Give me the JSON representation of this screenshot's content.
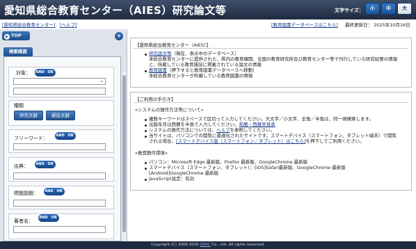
{
  "header": {
    "title": "愛知県総合教育センター（AIES）研究論文等",
    "font_size_label": "文字サイズ：",
    "font_sizes": [
      "小",
      "中",
      "大"
    ],
    "font_size_active": "大"
  },
  "linkbar": {
    "home_link": "[愛知県総合教育センター]",
    "help_link": "[ヘルプ]",
    "db_link": "[教育図書データベースはこちら]",
    "updated": "最終更新日： 2025年10月16日"
  },
  "left": {
    "top_label": "TOP",
    "top_icon": "arrow-icon",
    "add_icon": "plus-icon",
    "tab_label": "検索画面",
    "fields": {
      "target_label": "対象：",
      "type_label": "種類",
      "type_buttons": [
        "研究文献",
        "雑誌文献"
      ],
      "freeword_label": "フリーワード：",
      "source_label": "出典：",
      "title_label": "標題副題：",
      "author_label": "著者名："
    },
    "and_label": "AND",
    "or_label": "OR"
  },
  "main": {
    "about_title": "【愛知県総合教育センター（AIES）】",
    "about_items": [
      {
        "link": "研究論文等",
        "suffix": "（現在、表示中のデータベース）",
        "desc1": "本総合教育センターに提供された、県内の教育機関、全国の教育研究所及び教育センター等で刊行している研究紀要の情報",
        "desc2": "と、所蔵している教育雑誌に掲載されている論文の情報"
      },
      {
        "link": "教育図書",
        "suffix": "（押下すると教育図書データベースへ移動）",
        "desc1": "本総合教育センターが所蔵している教育図書の情報",
        "desc2": ""
      }
    ],
    "guide_title": "【ご利用の手引き】",
    "system_heading": "«システムの操作方法等について»",
    "system_items": [
      {
        "pre": "複数キーワードはスペースで区切って入力してください。大文字／小文字、全角／半角は、同一視検索します。",
        "link": "",
        "post": ""
      },
      {
        "pre": "出版年月は西暦を半角で入力してください。",
        "link": "和暦・西暦早見表",
        "post": ""
      },
      {
        "pre": "システムの操作方法については、",
        "link": "ヘルプ",
        "post": "を参照してください。"
      },
      {
        "pre": "当サイトは、パソコンでの閲覧に最適化されたサイトです。スマートデバイス（スマートフォン、タブレット端末）で閲覧",
        "link": "",
        "post": ""
      }
    ],
    "system_cont_pre": "される場合、",
    "system_cont_link": "[スマートデバイス版（スマートフォン／タブレット）はこちら]",
    "system_cont_post": "を押下してご利用ください。",
    "env_heading": "«推奨動作環境»",
    "env_items": [
      "パソコン：Microsoft Edge 最新版、Firefox 最新版、GoogleChrome 最新版",
      "スマートデバイス（スマートフォン、タブレット）：[iOS]Safari最新版、GoogleChrome 最新版",
      "JavaScript設定：有効"
    ],
    "env_cont": "[Android]GoogleChrome 最新版"
  },
  "footer": {
    "copyright_pre": "Copyright (C) 2006-2025 ",
    "copyright_link": "OPAC",
    "copyright_post": " Co., Ltd. All rights reserved."
  }
}
